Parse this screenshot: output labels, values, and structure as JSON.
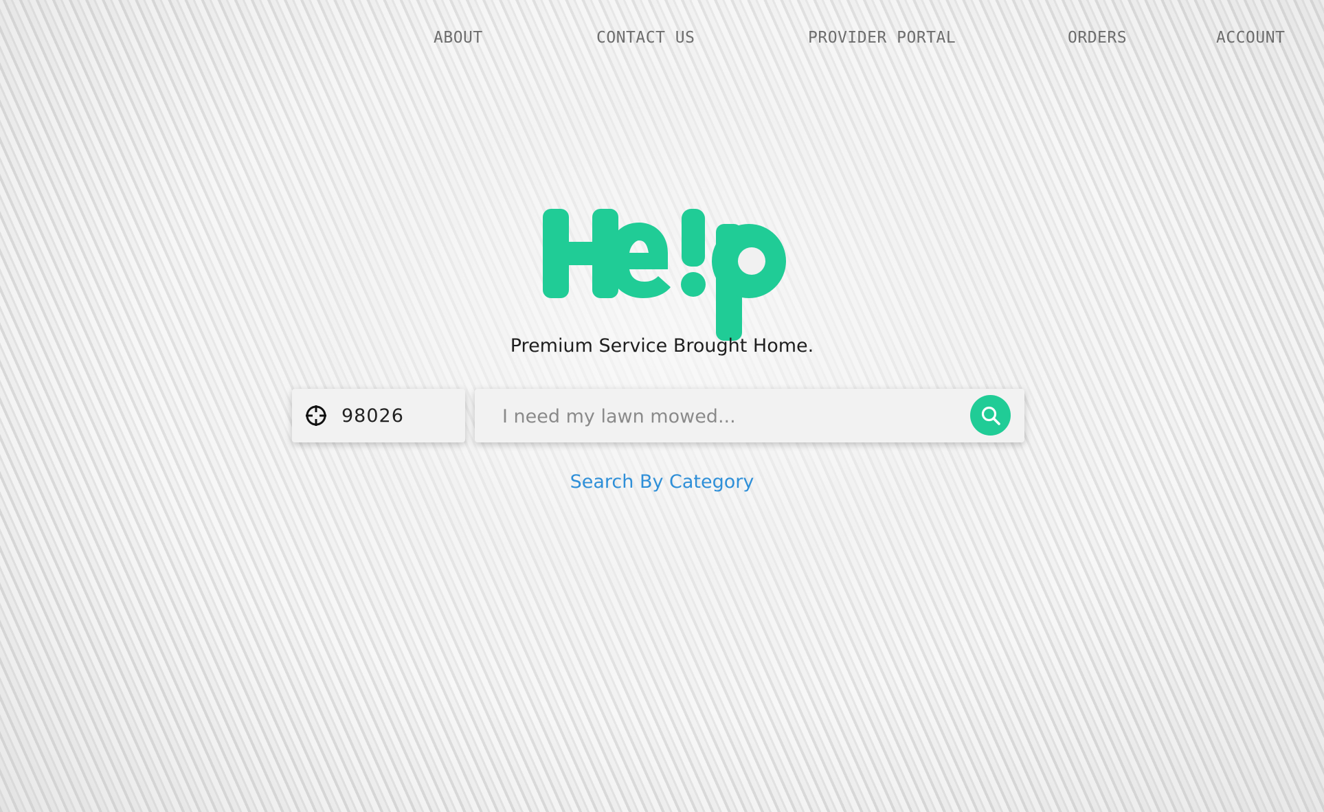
{
  "nav": {
    "about": "ABOUT",
    "contact": "CONTACT US",
    "provider_portal": "PROVIDER PORTAL",
    "orders": "ORDERS",
    "account": "ACCOUNT"
  },
  "brand": {
    "logo_text": "He!p",
    "logo_color": "#20cc96"
  },
  "hero": {
    "tagline": "Premium Service Brought Home."
  },
  "search": {
    "zip_value": "98026",
    "query_placeholder": "I need my lawn mowed...",
    "locate_icon": "crosshair-icon",
    "search_icon": "magnifier-icon",
    "button_color": "#20cc96"
  },
  "links": {
    "search_by_category": "Search By Category",
    "link_color": "#2e8fd8"
  }
}
